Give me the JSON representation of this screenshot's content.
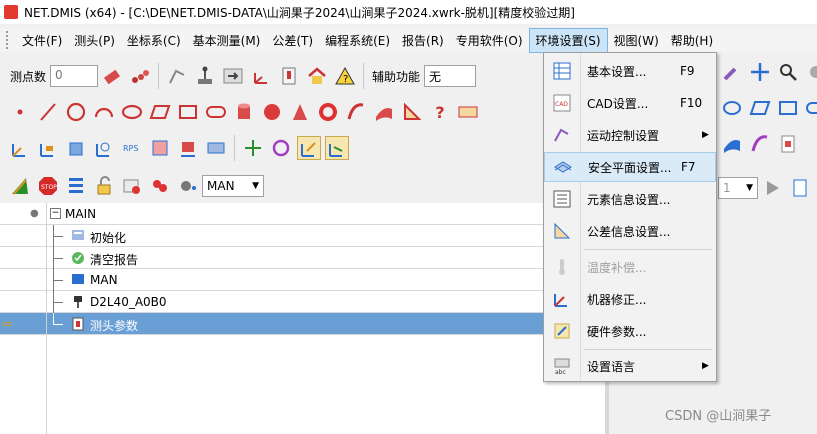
{
  "window": {
    "title": "NET.DMIS (x64) - [C:\\DE\\NET.DMIS-DATA\\山涧果子2024\\山涧果子2024.xwrk-脱机][精度校验过期]"
  },
  "menubar": {
    "items": [
      {
        "id": "file",
        "label": "文件(F)"
      },
      {
        "id": "probe",
        "label": "测头(P)"
      },
      {
        "id": "coord",
        "label": "坐标系(C)"
      },
      {
        "id": "basic",
        "label": "基本测量(M)"
      },
      {
        "id": "tol",
        "label": "公差(T)"
      },
      {
        "id": "prog",
        "label": "编程系统(E)"
      },
      {
        "id": "report",
        "label": "报告(R)"
      },
      {
        "id": "special",
        "label": "专用软件(O)"
      },
      {
        "id": "env",
        "label": "环境设置(S)"
      },
      {
        "id": "view",
        "label": "视图(W)"
      },
      {
        "id": "help",
        "label": "帮助(H)"
      }
    ]
  },
  "toolbar1": {
    "points_label": "测点数",
    "points_value": "0",
    "aux_label": "辅助功能",
    "aux_value": "无"
  },
  "toolbar4": {
    "mode_value": "MAN",
    "page_value": "1"
  },
  "tree": {
    "root": "MAIN",
    "nodes": [
      {
        "label": "初始化",
        "sub": "Init"
      },
      {
        "label": "清空报告",
        "sub": ""
      },
      {
        "label": "MAN",
        "sub": "Mode"
      },
      {
        "label": "D2L40_A0B0",
        "sub": ""
      },
      {
        "label": "测头参数",
        "sub": ""
      }
    ]
  },
  "dropdown": {
    "items": [
      {
        "label": "基本设置...",
        "shortcut": "F9",
        "icon": "grid-settings-icon"
      },
      {
        "label": "CAD设置...",
        "shortcut": "F10",
        "icon": "cad-icon"
      },
      {
        "label": "运动控制设置",
        "shortcut": "",
        "icon": "motion-icon",
        "submenu": "▶"
      },
      {
        "label": "安全平面设置...",
        "shortcut": "F7",
        "icon": "safe-plane-icon"
      },
      {
        "label": "元素信息设置...",
        "shortcut": "",
        "icon": "element-info-icon"
      },
      {
        "label": "公差信息设置...",
        "shortcut": "",
        "icon": "tolerance-info-icon"
      },
      {
        "label": "温度补偿...",
        "shortcut": "",
        "icon": "temperature-icon"
      },
      {
        "label": "机器修正...",
        "shortcut": "",
        "icon": "machine-correction-icon"
      },
      {
        "label": "硬件参数...",
        "shortcut": "",
        "icon": "hardware-icon"
      },
      {
        "label": "设置语言",
        "shortcut": "",
        "icon": "language-icon",
        "submenu": "▶"
      }
    ]
  },
  "watermark": "CSDN @山涧果子"
}
